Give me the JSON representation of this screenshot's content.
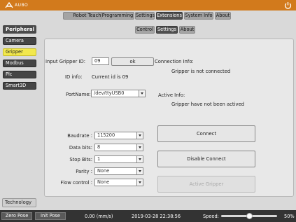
{
  "app": {
    "logo_text": "AUBO"
  },
  "top_tabs": [
    {
      "label": "Robot Teaching"
    },
    {
      "label": "Programming"
    },
    {
      "label": "Settings"
    },
    {
      "label": "Extensions"
    },
    {
      "label": "System Info"
    },
    {
      "label": "About"
    }
  ],
  "sub_tabs": [
    {
      "label": "Control"
    },
    {
      "label": "Settings"
    },
    {
      "label": "About"
    }
  ],
  "sidebar": {
    "title": "Peripheral",
    "items": [
      {
        "label": "Camera"
      },
      {
        "label": "Gripper"
      },
      {
        "label": "Modbus"
      },
      {
        "label": "Plc"
      },
      {
        "label": "Smart3D"
      }
    ],
    "bottom_button": "Technology"
  },
  "gripper": {
    "input_id_label": "Input Gripper ID:",
    "input_id_value": "09",
    "ok_label": "ok",
    "id_info_label": "ID info:",
    "id_info_value": "Current id is 09",
    "portname_label": "PortName:",
    "portname_value": "/dev/ttyUSB0",
    "connection_info_label": "Connection Info:",
    "connection_info_value": "Gripper is not connected",
    "active_info_label": "Active Info:",
    "active_info_value": "Gripper have not been actived",
    "baudrate_label": "Baudrate :",
    "baudrate_value": "115200",
    "databits_label": "Data bits:",
    "databits_value": "8",
    "stopbits_label": "Stop Bits:",
    "stopbits_value": "1",
    "parity_label": "Parity :",
    "parity_value": "None",
    "flow_label": "Flow control :",
    "flow_value": "None",
    "connect_label": "Connect",
    "disable_connect_label": "Disable Connect",
    "active_gripper_label": "Active Gripper"
  },
  "status_bar": {
    "zero_pose": "Zero Pose",
    "init_pose": "Init Pose",
    "speed_value": "0.00 (mm/s)",
    "timestamp": "2019-03-28 22:38:56",
    "speed_label": "Speed:",
    "speed_percent_text": "50%",
    "speed_fraction": 0.5
  },
  "colors": {
    "brand_orange": "#d27a1c",
    "active_tab": "#4f4f4f",
    "sidebar_active": "#f2e84d"
  }
}
